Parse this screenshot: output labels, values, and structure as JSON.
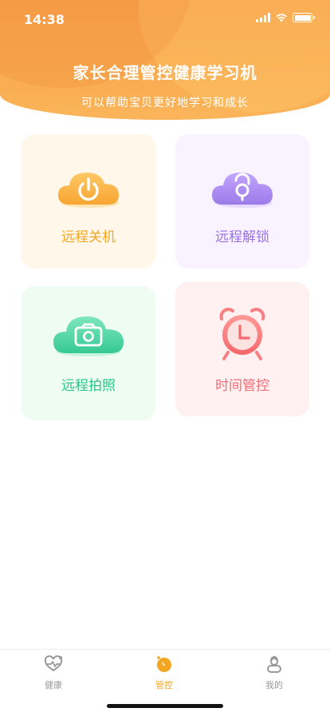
{
  "status_bar": {
    "time": "14:38"
  },
  "header": {
    "title": "家长合理管控健康学习机",
    "subtitle": "可以帮助宝贝更好地学习和成长"
  },
  "cards": [
    {
      "label": "远程关机",
      "icon": "power-cloud-icon",
      "color": "#f4a623",
      "bg": "#fff8ea"
    },
    {
      "label": "远程解锁",
      "icon": "unlock-cloud-icon",
      "color": "#9a72e8",
      "bg": "#f8f3ff"
    },
    {
      "label": "远程拍照",
      "icon": "camera-cloud-icon",
      "color": "#2cc48a",
      "bg": "#effcf2"
    },
    {
      "label": "时间管控",
      "icon": "alarm-clock-icon",
      "color": "#f26e74",
      "bg": "#fff0f1"
    }
  ],
  "tabbar": {
    "items": [
      {
        "label": "健康",
        "icon": "health-icon",
        "active": false
      },
      {
        "label": "管控",
        "icon": "control-icon",
        "active": true
      },
      {
        "label": "我的",
        "icon": "profile-icon",
        "active": false
      }
    ],
    "active_color": "#f4a623",
    "inactive_color": "#9a9a9a"
  }
}
